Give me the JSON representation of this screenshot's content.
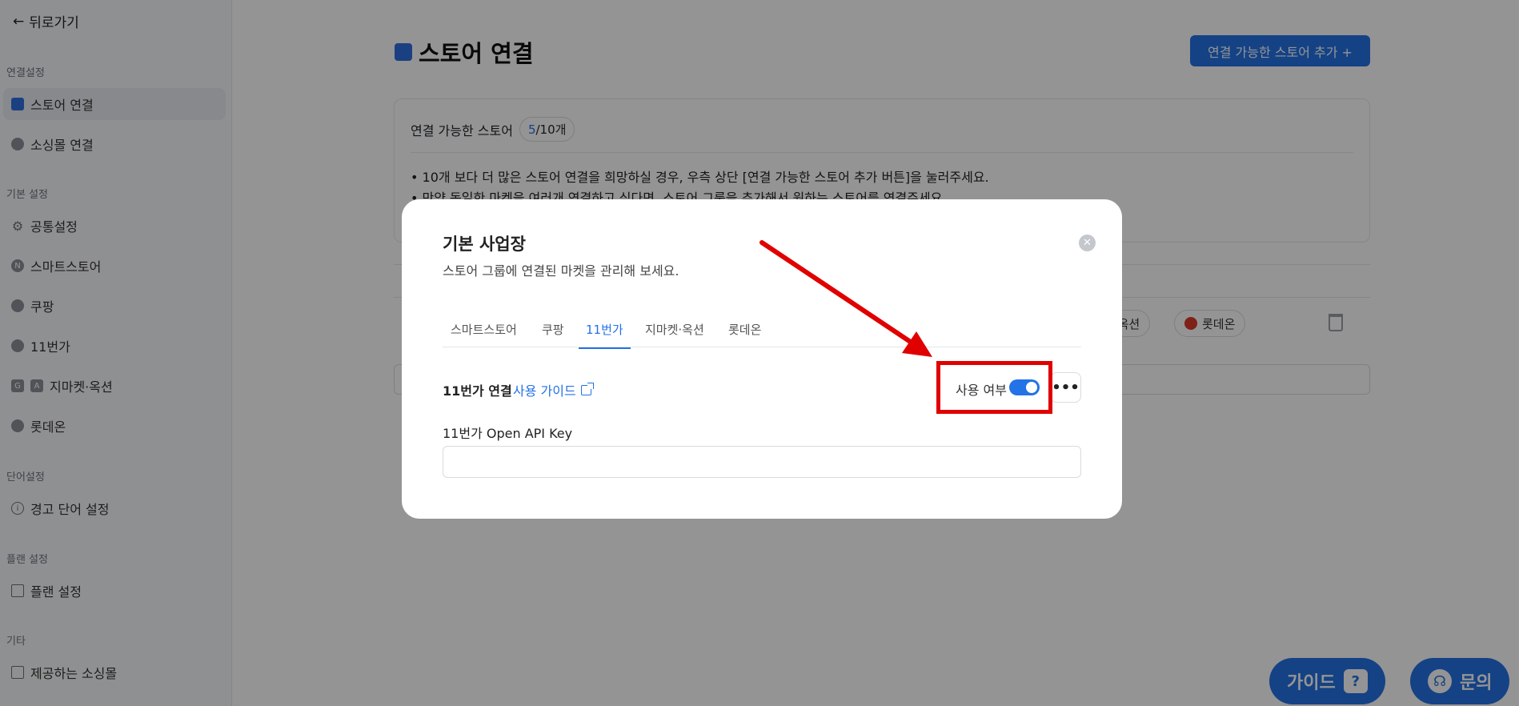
{
  "sidebar": {
    "back_label": "뒤로가기",
    "sections": [
      {
        "label": "연결설정",
        "items": [
          {
            "label": "스토어 연결",
            "active": true
          },
          {
            "label": "소싱몰 연결"
          }
        ]
      },
      {
        "label": "기본 설정",
        "items": [
          {
            "label": "공통설정"
          },
          {
            "label": "스마트스토어"
          },
          {
            "label": "쿠팡"
          },
          {
            "label": "11번가"
          },
          {
            "label": "지마켓·옥션"
          },
          {
            "label": "롯데온"
          }
        ]
      },
      {
        "label": "단어설정",
        "items": [
          {
            "label": "경고 단어 설정"
          }
        ]
      },
      {
        "label": "플랜 설정",
        "items": [
          {
            "label": "플랜 설정"
          }
        ]
      },
      {
        "label": "기타",
        "items": [
          {
            "label": "제공하는 소싱몰"
          }
        ]
      }
    ]
  },
  "main": {
    "title": "스토어 연결",
    "add_button": "연결 가능한 스토어 추가 +",
    "card": {
      "label": "연결 가능한 스토어",
      "count_used": "5",
      "count_total": "/10개",
      "bullets": [
        "• 10개 보다 더 많은 스토어 연결을 희망하실 경우, 우측 상단 [연결 가능한 스토어 추가 버튼]을 눌러주세요.",
        "• 만약 동일한 마켓을 여러개 연결하고 싶다면, 스토어 그룹을 추가해서 원하는 스토어를 연결주세요."
      ]
    },
    "chips": [
      "켓·옥션",
      "롯데온"
    ]
  },
  "floating": {
    "guide": "가이드",
    "inquiry": "문의"
  },
  "modal": {
    "title": "기본 사업장",
    "subtitle": "스토어 그룹에 연결된 마켓을 관리해 보세요.",
    "tabs": [
      "스마트스토어",
      "쿠팡",
      "11번가",
      "지마켓·옥션",
      "롯데온"
    ],
    "active_tab": "11번가",
    "connect_title": "11번가 연결",
    "guide_link": "사용 가이드",
    "use_label": "사용 여부",
    "use_enabled": true,
    "more_label": "•••",
    "api_label": "11번가 Open API Key",
    "api_value": "",
    "close_label": "✕"
  },
  "colors": {
    "accent": "#2372e6",
    "annotation": "#e00000"
  }
}
